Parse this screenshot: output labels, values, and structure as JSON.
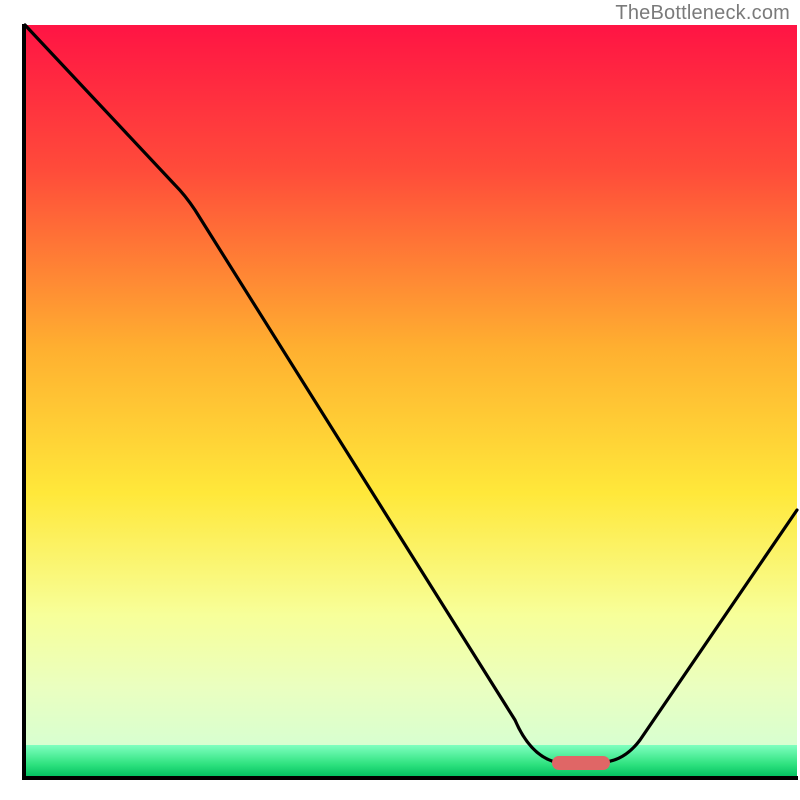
{
  "watermark": "TheBottleneck.com",
  "chart_data": {
    "type": "line",
    "title": "",
    "xlabel": "",
    "ylabel": "",
    "xlim": [
      0,
      100
    ],
    "ylim": [
      0,
      100
    ],
    "gradient": {
      "top": "#ff1444",
      "mid1": "#ff8a2a",
      "mid2": "#ffe83a",
      "mid3": "#f7ff9a",
      "bottom_band": "#2fe27f",
      "bottom_line": "#00c060"
    },
    "curve": {
      "description": "V-shaped bottleneck curve with minimum near x≈73",
      "points": [
        [
          1.5,
          99.5
        ],
        [
          20,
          79
        ],
        [
          65,
          7
        ],
        [
          68,
          2.2
        ],
        [
          72,
          1.8
        ],
        [
          77,
          2.2
        ],
        [
          99,
          35
        ]
      ]
    },
    "marker": {
      "x": 72,
      "y": 2.0,
      "color": "#e06666",
      "width": 6,
      "height": 2
    },
    "axes": {
      "color": "#000000",
      "thickness": 3
    }
  }
}
